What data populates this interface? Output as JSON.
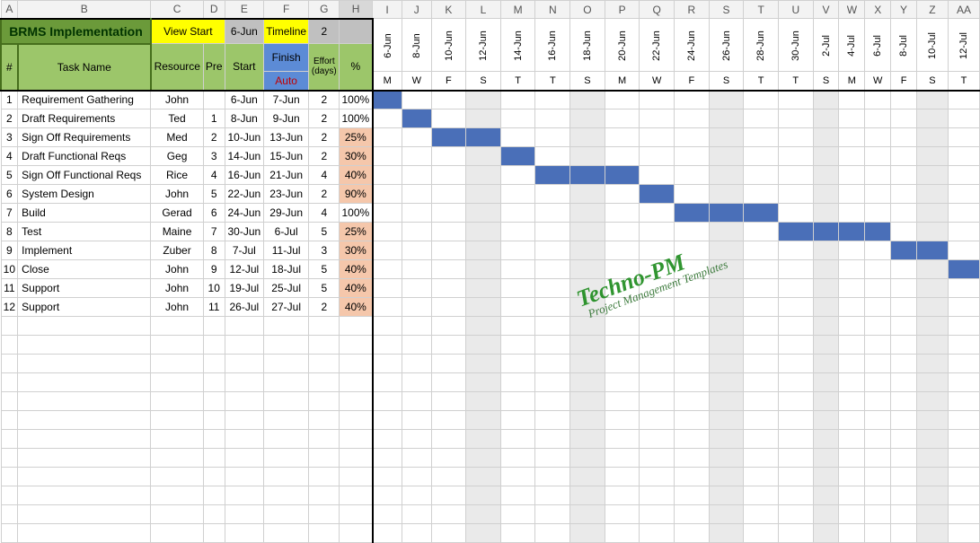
{
  "columns_left": [
    "A",
    "B",
    "C",
    "D",
    "E",
    "F",
    "G",
    "H"
  ],
  "columns_right": [
    "I",
    "J",
    "K",
    "L",
    "M",
    "N",
    "O",
    "P",
    "Q",
    "R",
    "S",
    "T",
    "U",
    "V",
    "W",
    "X",
    "Y",
    "Z",
    "AA"
  ],
  "title": "BRMS Implementation",
  "view_start_label": "View Start",
  "view_start_value": "6-Jun",
  "timeline_label": "Timeline",
  "timeline_value": "2",
  "hdr": {
    "num": "#",
    "task": "Task Name",
    "resource": "Resource",
    "pre": "Pre",
    "start": "Start",
    "finish": "Finish",
    "auto": "Auto",
    "effort": "Effort (days)",
    "pct": "%"
  },
  "dates": [
    "6-Jun",
    "8-Jun",
    "10-Jun",
    "12-Jun",
    "14-Jun",
    "16-Jun",
    "18-Jun",
    "20-Jun",
    "22-Jun",
    "24-Jun",
    "26-Jun",
    "28-Jun",
    "30-Jun",
    "2-Jul",
    "4-Jul",
    "6-Jul",
    "8-Jul",
    "10-Jul",
    "12-Jul"
  ],
  "dows": [
    "M",
    "W",
    "F",
    "S",
    "T",
    "T",
    "S",
    "M",
    "W",
    "F",
    "S",
    "T",
    "T",
    "S",
    "M",
    "W",
    "F",
    "S",
    "T"
  ],
  "weekend_cols": [
    3,
    6,
    10,
    13,
    17
  ],
  "rows": [
    {
      "n": "1",
      "task": "Requirement Gathering",
      "res": "John",
      "pre": "",
      "start": "6-Jun",
      "finish": "7-Jun",
      "effort": "2",
      "pct": "100%",
      "peach": false,
      "bars": [
        0
      ]
    },
    {
      "n": "2",
      "task": "Draft  Requirements",
      "res": "Ted",
      "pre": "1",
      "start": "8-Jun",
      "finish": "9-Jun",
      "effort": "2",
      "pct": "100%",
      "peach": false,
      "bars": [
        1
      ]
    },
    {
      "n": "3",
      "task": "Sign Off  Requirements",
      "res": "Med",
      "pre": "2",
      "start": "10-Jun",
      "finish": "13-Jun",
      "effort": "2",
      "pct": "25%",
      "peach": true,
      "bars": [
        2,
        3
      ]
    },
    {
      "n": "4",
      "task": "Draft Functional Reqs",
      "res": "Geg",
      "pre": "3",
      "start": "14-Jun",
      "finish": "15-Jun",
      "effort": "2",
      "pct": "30%",
      "peach": true,
      "bars": [
        4
      ]
    },
    {
      "n": "5",
      "task": "Sign Off Functional Reqs",
      "res": "Rice",
      "pre": "4",
      "start": "16-Jun",
      "finish": "21-Jun",
      "effort": "4",
      "pct": "40%",
      "peach": true,
      "bars": [
        5,
        6,
        7
      ]
    },
    {
      "n": "6",
      "task": "System Design",
      "res": "John",
      "pre": "5",
      "start": "22-Jun",
      "finish": "23-Jun",
      "effort": "2",
      "pct": "90%",
      "peach": true,
      "bars": [
        8
      ]
    },
    {
      "n": "7",
      "task": "Build",
      "res": "Gerad",
      "pre": "6",
      "start": "24-Jun",
      "finish": "29-Jun",
      "effort": "4",
      "pct": "100%",
      "peach": false,
      "bars": [
        9,
        10,
        11
      ]
    },
    {
      "n": "8",
      "task": "Test",
      "res": "Maine",
      "pre": "7",
      "start": "30-Jun",
      "finish": "6-Jul",
      "effort": "5",
      "pct": "25%",
      "peach": true,
      "bars": [
        12,
        13,
        14,
        15
      ]
    },
    {
      "n": "9",
      "task": "Implement",
      "res": "Zuber",
      "pre": "8",
      "start": "7-Jul",
      "finish": "11-Jul",
      "effort": "3",
      "pct": "30%",
      "peach": true,
      "bars": [
        16,
        17
      ]
    },
    {
      "n": "10",
      "task": "Close",
      "res": "John",
      "pre": "9",
      "start": "12-Jul",
      "finish": "18-Jul",
      "effort": "5",
      "pct": "40%",
      "peach": true,
      "bars": [
        18
      ]
    },
    {
      "n": "11",
      "task": "Support",
      "res": "John",
      "pre": "10",
      "start": "19-Jul",
      "finish": "25-Jul",
      "effort": "5",
      "pct": "40%",
      "peach": true,
      "bars": []
    },
    {
      "n": "12",
      "task": "Support",
      "res": "John",
      "pre": "11",
      "start": "26-Jul",
      "finish": "27-Jul",
      "effort": "2",
      "pct": "40%",
      "peach": true,
      "bars": []
    }
  ],
  "empty_rows": 12,
  "watermark": {
    "line1": "Techno-PM",
    "line2": "Project Management Templates"
  },
  "chart_data": {
    "type": "table",
    "title": "BRMS Implementation — Gantt",
    "columns": [
      "#",
      "Task Name",
      "Resource",
      "Pre",
      "Start",
      "Finish",
      "Effort (days)",
      "%"
    ],
    "tasks": [
      {
        "id": 1,
        "name": "Requirement Gathering",
        "resource": "John",
        "predecessor": null,
        "start": "6-Jun",
        "finish": "7-Jun",
        "effort_days": 2,
        "pct_complete": 100
      },
      {
        "id": 2,
        "name": "Draft Requirements",
        "resource": "Ted",
        "predecessor": 1,
        "start": "8-Jun",
        "finish": "9-Jun",
        "effort_days": 2,
        "pct_complete": 100
      },
      {
        "id": 3,
        "name": "Sign Off Requirements",
        "resource": "Med",
        "predecessor": 2,
        "start": "10-Jun",
        "finish": "13-Jun",
        "effort_days": 2,
        "pct_complete": 25
      },
      {
        "id": 4,
        "name": "Draft Functional Reqs",
        "resource": "Geg",
        "predecessor": 3,
        "start": "14-Jun",
        "finish": "15-Jun",
        "effort_days": 2,
        "pct_complete": 30
      },
      {
        "id": 5,
        "name": "Sign Off Functional Reqs",
        "resource": "Rice",
        "predecessor": 4,
        "start": "16-Jun",
        "finish": "21-Jun",
        "effort_days": 4,
        "pct_complete": 40
      },
      {
        "id": 6,
        "name": "System Design",
        "resource": "John",
        "predecessor": 5,
        "start": "22-Jun",
        "finish": "23-Jun",
        "effort_days": 2,
        "pct_complete": 90
      },
      {
        "id": 7,
        "name": "Build",
        "resource": "Gerad",
        "predecessor": 6,
        "start": "24-Jun",
        "finish": "29-Jun",
        "effort_days": 4,
        "pct_complete": 100
      },
      {
        "id": 8,
        "name": "Test",
        "resource": "Maine",
        "predecessor": 7,
        "start": "30-Jun",
        "finish": "6-Jul",
        "effort_days": 5,
        "pct_complete": 25
      },
      {
        "id": 9,
        "name": "Implement",
        "resource": "Zuber",
        "predecessor": 8,
        "start": "7-Jul",
        "finish": "11-Jul",
        "effort_days": 3,
        "pct_complete": 30
      },
      {
        "id": 10,
        "name": "Close",
        "resource": "John",
        "predecessor": 9,
        "start": "12-Jul",
        "finish": "18-Jul",
        "effort_days": 5,
        "pct_complete": 40
      },
      {
        "id": 11,
        "name": "Support",
        "resource": "John",
        "predecessor": 10,
        "start": "19-Jul",
        "finish": "25-Jul",
        "effort_days": 5,
        "pct_complete": 40
      },
      {
        "id": 12,
        "name": "Support",
        "resource": "John",
        "predecessor": 11,
        "start": "26-Jul",
        "finish": "27-Jul",
        "effort_days": 2,
        "pct_complete": 40
      }
    ],
    "timeline_dates": [
      "6-Jun",
      "8-Jun",
      "10-Jun",
      "12-Jun",
      "14-Jun",
      "16-Jun",
      "18-Jun",
      "20-Jun",
      "22-Jun",
      "24-Jun",
      "26-Jun",
      "28-Jun",
      "30-Jun",
      "2-Jul",
      "4-Jul",
      "6-Jul",
      "8-Jul",
      "10-Jul",
      "12-Jul"
    ]
  }
}
